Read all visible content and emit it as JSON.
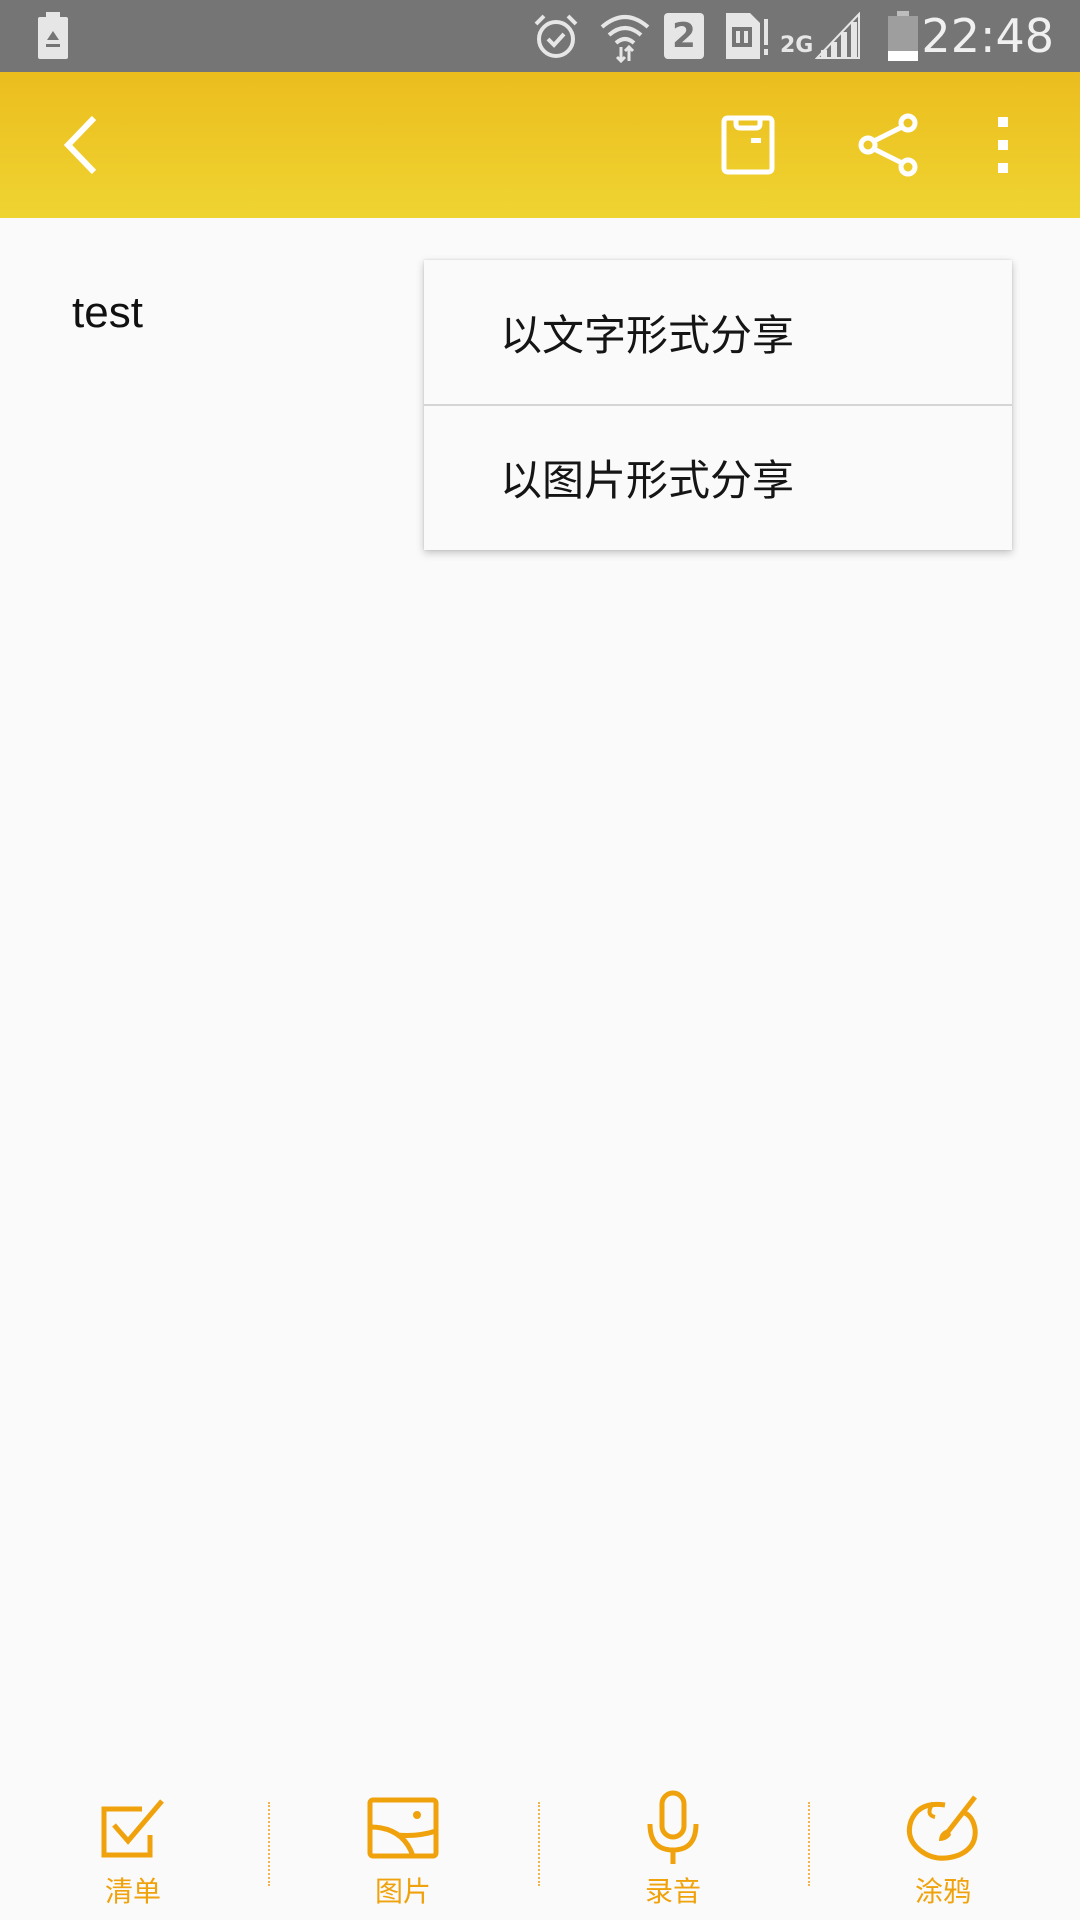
{
  "status_bar": {
    "time": "22:48",
    "sim_badge": "2",
    "network_type": "2G",
    "icons": [
      "recycle-battery-icon",
      "alarm-icon",
      "wifi-icon",
      "sim-2-icon",
      "sim-card-icon",
      "signal-icon",
      "battery-icon"
    ]
  },
  "app_bar": {
    "color_top": "#ebbd1e",
    "color_bottom": "#efd431",
    "icons": [
      "back-icon",
      "save-icon",
      "share-icon",
      "more-vert-icon"
    ]
  },
  "note": {
    "body": "test"
  },
  "share_menu": {
    "items": [
      {
        "label": "以文字形式分享"
      },
      {
        "label": "以图片形式分享"
      }
    ]
  },
  "toolbar": {
    "accent": "#f0a20c",
    "items": [
      {
        "label": "清单",
        "icon": "checklist-icon"
      },
      {
        "label": "图片",
        "icon": "image-icon"
      },
      {
        "label": "录音",
        "icon": "microphone-icon"
      },
      {
        "label": "涂鸦",
        "icon": "paint-palette-icon"
      }
    ]
  }
}
